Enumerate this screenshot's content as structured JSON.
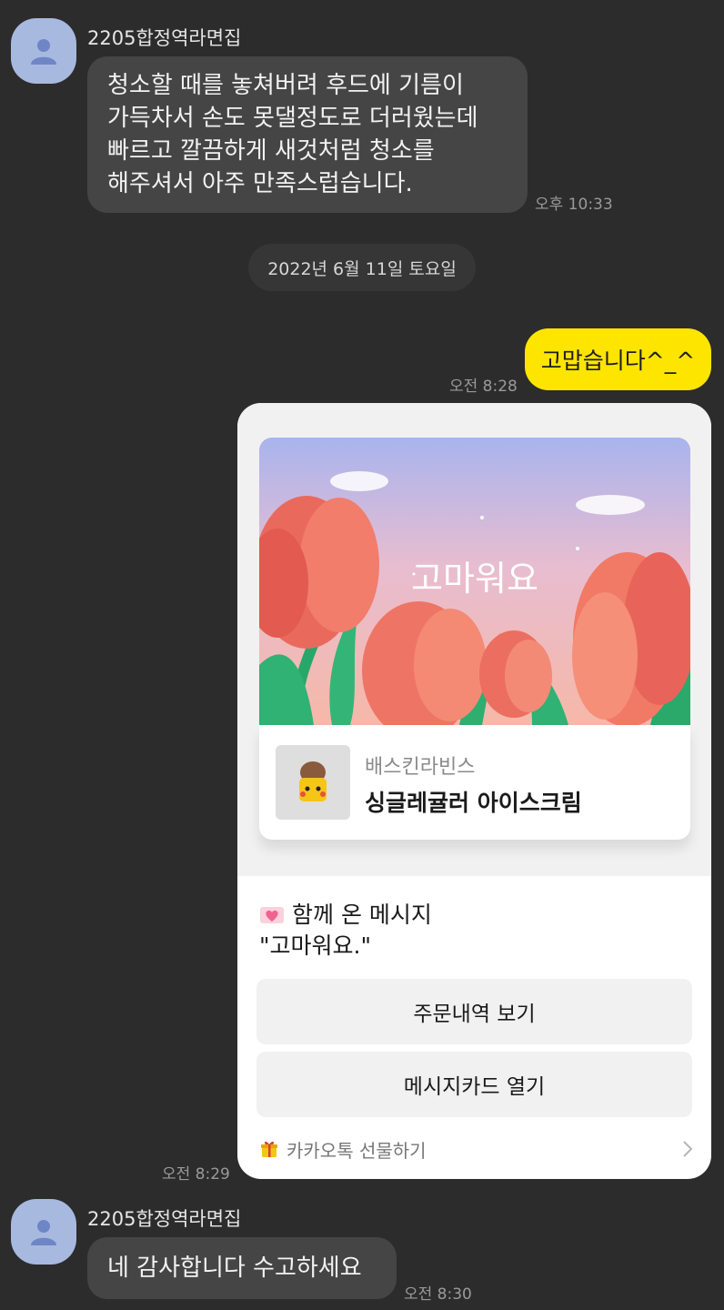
{
  "messages": {
    "first": {
      "sender": "2205합정역라면집",
      "lines": [
        "청소할 때를 놓쳐버려 후드에 기름이",
        "가득차서 손도 못댈정도로 더러웠는데",
        "빠르고 깔끔하게 새것처럼 청소를",
        "해주셔서 아주 만족스럽습니다."
      ],
      "time": "오후 10:33"
    },
    "date_divider": "2022년 6월 11일 토요일",
    "reply": {
      "text": "고맙습니다^_^",
      "time": "오전 8:28"
    },
    "gift": {
      "banner_text": "고마워요",
      "brand": "배스킨라빈스",
      "product": "싱글레귤러 아이스크림",
      "message_label": "함께 온 메시지",
      "message_text": "\"고마워요.\"",
      "button_order": "주문내역 보기",
      "button_card": "메시지카드 열기",
      "footer": "카카오톡 선물하기",
      "time": "오전 8:29"
    },
    "last": {
      "sender": "2205합정역라면집",
      "text": "네 감사합니다 수고하세요",
      "time": "오전 8:30"
    }
  },
  "icons": {
    "avatar": "person-icon",
    "heart": "heart-letter-icon",
    "gift_box": "gift-box-icon",
    "chevron": "chevron-right-icon"
  },
  "colors": {
    "background": "#2c2c2c",
    "incoming_bubble": "#454545",
    "outgoing_bubble": "#fee500"
  }
}
